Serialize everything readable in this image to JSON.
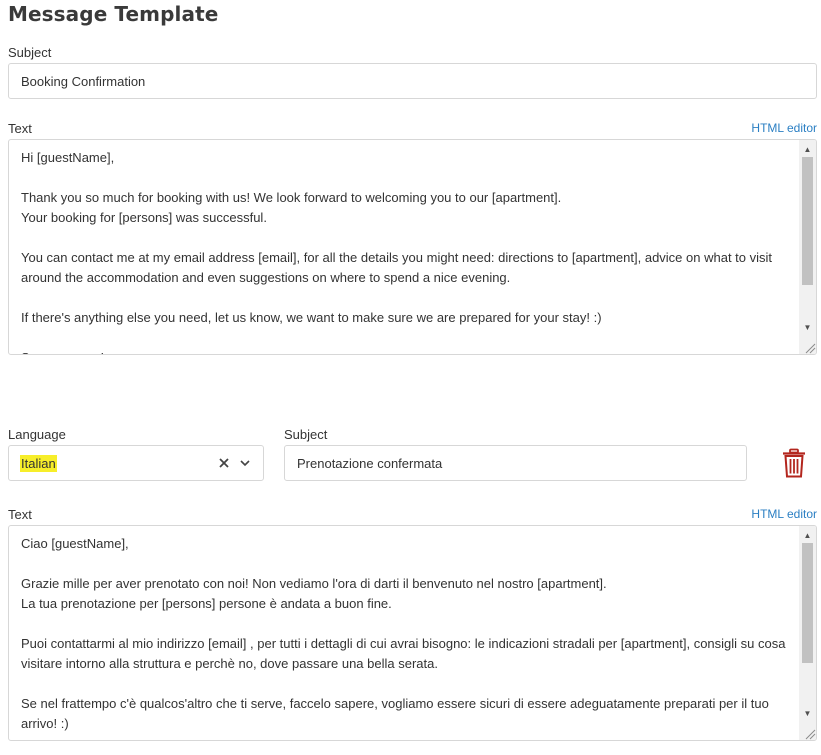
{
  "page": {
    "title": "Message Template"
  },
  "default_template": {
    "subject_label": "Subject",
    "subject_value": "Booking Confirmation",
    "text_label": "Text",
    "html_editor_label": "HTML editor",
    "text_lines": [
      "Hi [guestName],",
      "",
      "Thank you so much for booking with us! We look forward to welcoming you to our [apartment].",
      "Your booking for [persons] was successful.",
      "",
      "You can contact me at my email address [email], for all the details you might need: directions to [apartment], advice on what to visit",
      "around the accommodation and even suggestions on where to spend a nice evening.",
      "",
      "If there's anything else you need, let us know, we want to make sure we are prepared for your stay! :)",
      "",
      "See you soon!"
    ]
  },
  "translation": {
    "language_label": "Language",
    "language_value": "Italian",
    "subject_label": "Subject",
    "subject_value": "Prenotazione confermata",
    "text_label": "Text",
    "html_editor_label": "HTML editor",
    "text_lines": [
      "Ciao [guestName],",
      "",
      "Grazie mille per aver prenotato con noi! Non vediamo l'ora di darti il benvenuto nel nostro [apartment].",
      "La tua prenotazione per [persons] persone è andata a buon fine.",
      "",
      "Puoi contattarmi al mio indirizzo [email] , per tutti i dettagli di cui avrai bisogno: le indicazioni stradali per [apartment], consigli su cosa",
      "visitare intorno alla struttura e perchè no, dove passare una bella serata.",
      "",
      "Se nel frattempo c'è qualcos'altro che ti serve, faccelo sapere, vogliamo essere sicuri di essere adeguatamente preparati per il tuo",
      "arrivo! :)"
    ]
  },
  "colors": {
    "link": "#2b7fc3",
    "delete": "#b3261e",
    "highlight": "#f7ee2a",
    "border": "#d7d7d7"
  }
}
